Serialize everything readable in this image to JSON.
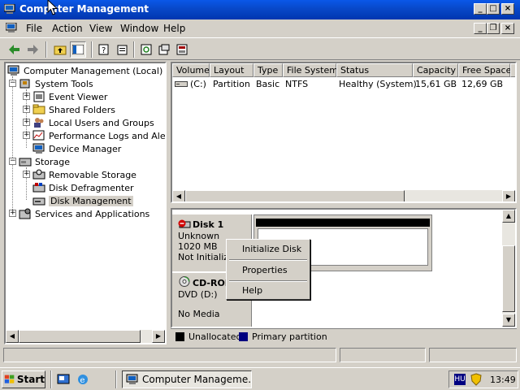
{
  "window": {
    "title": "Computer Management"
  },
  "menu": {
    "file": "File",
    "action": "Action",
    "view": "View",
    "window": "Window",
    "help": "Help"
  },
  "tree": {
    "root": "Computer Management (Local)",
    "system_tools": "System Tools",
    "event_viewer": "Event Viewer",
    "shared_folders": "Shared Folders",
    "local_users": "Local Users and Groups",
    "perf_logs": "Performance Logs and Alerts",
    "device_manager": "Device Manager",
    "storage": "Storage",
    "removable_storage": "Removable Storage",
    "disk_defrag": "Disk Defragmenter",
    "disk_management": "Disk Management",
    "services": "Services and Applications"
  },
  "volumes": {
    "headers": [
      "Volume",
      "Layout",
      "Type",
      "File System",
      "Status",
      "Capacity",
      "Free Space"
    ],
    "rows": [
      {
        "volume": "(C:)",
        "layout": "Partition",
        "type": "Basic",
        "fs": "NTFS",
        "status": "Healthy (System)",
        "capacity": "15,61 GB",
        "free": "12,69 GB"
      }
    ]
  },
  "disks": {
    "disk1": {
      "name": "Disk 1",
      "kind": "Unknown",
      "size": "1020 MB",
      "state": "Not Initialize"
    },
    "cdrom": {
      "name": "CD-ROM",
      "kind": "DVD (D:)",
      "state": "No Media"
    }
  },
  "legend": {
    "unallocated": "Unallocated",
    "primary": "Primary partition",
    "unallocated_color": "#000000",
    "primary_color": "#000080"
  },
  "context_menu": {
    "initialize": "Initialize Disk",
    "properties": "Properties",
    "help": "Help"
  },
  "taskbar": {
    "start": "Start",
    "window": "Computer Manageme...",
    "lang": "HU",
    "clock": "13:49"
  },
  "colors": {
    "titlebar": "#0848c8",
    "desktop_face": "#d4d0c8"
  }
}
